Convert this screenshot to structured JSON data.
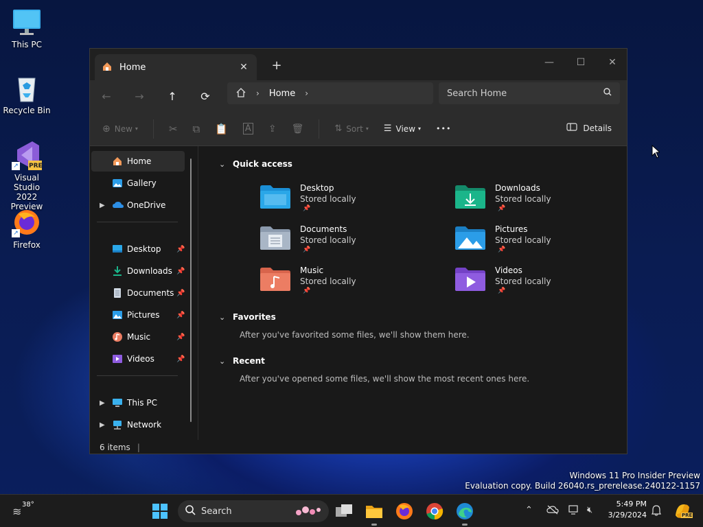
{
  "desktop": {
    "icons": [
      {
        "label": "This PC",
        "icon": "monitor-icon"
      },
      {
        "label": "Recycle Bin",
        "icon": "recycle-bin-icon"
      },
      {
        "label": "Visual Studio 2022 Preview",
        "icon": "visual-studio-icon",
        "badge": "PRE"
      },
      {
        "label": "Firefox",
        "icon": "firefox-icon"
      }
    ],
    "watermark": {
      "line1": "Windows 11 Pro Insider Preview",
      "line2": "Evaluation copy. Build 26040.rs_prerelease.240122-1157"
    }
  },
  "window": {
    "tab": {
      "label": "Home",
      "icon": "home-icon"
    },
    "controls": {
      "minimize": "—",
      "maximize": "☐",
      "close": "✕"
    },
    "address": {
      "crumbs": [
        "Home"
      ]
    },
    "search": {
      "placeholder": "Search Home"
    },
    "toolbar": {
      "new_label": "New",
      "sort_label": "Sort",
      "view_label": "View",
      "more_label": "•••",
      "details_label": "Details"
    },
    "sidebar": {
      "top": [
        {
          "label": "Home",
          "icon": "home-icon",
          "selected": true
        },
        {
          "label": "Gallery",
          "icon": "gallery-icon"
        },
        {
          "label": "OneDrive",
          "icon": "cloud-icon",
          "expandable": true
        }
      ],
      "pinned": [
        {
          "label": "Desktop",
          "icon": "desktop-folder-icon"
        },
        {
          "label": "Downloads",
          "icon": "download-icon"
        },
        {
          "label": "Documents",
          "icon": "documents-icon"
        },
        {
          "label": "Pictures",
          "icon": "pictures-icon"
        },
        {
          "label": "Music",
          "icon": "music-icon"
        },
        {
          "label": "Videos",
          "icon": "videos-icon"
        }
      ],
      "bottom": [
        {
          "label": "This PC",
          "icon": "monitor-icon",
          "expandable": true
        },
        {
          "label": "Network",
          "icon": "network-icon",
          "expandable": true
        }
      ]
    },
    "quick_access": {
      "title": "Quick access",
      "items": [
        {
          "name": "Desktop",
          "status": "Stored locally",
          "color": "#2aa7e8"
        },
        {
          "name": "Downloads",
          "status": "Stored locally",
          "color": "#1bb58a"
        },
        {
          "name": "Documents",
          "status": "Stored locally",
          "color": "#a9b6c6"
        },
        {
          "name": "Pictures",
          "status": "Stored locally",
          "color": "#2b9de8"
        },
        {
          "name": "Music",
          "status": "Stored locally",
          "color": "#ec7d63"
        },
        {
          "name": "Videos",
          "status": "Stored locally",
          "color": "#8f5ce0"
        }
      ]
    },
    "favorites": {
      "title": "Favorites",
      "hint": "After you've favorited some files, we'll show them here."
    },
    "recent": {
      "title": "Recent",
      "hint": "After you've opened some files, we'll show the most recent ones here."
    },
    "status": {
      "items": "6 items"
    }
  },
  "taskbar": {
    "weather": "38°",
    "search_label": "Search",
    "time": "5:49 PM",
    "date": "3/29/2024",
    "copilot_badge": "PRE"
  }
}
